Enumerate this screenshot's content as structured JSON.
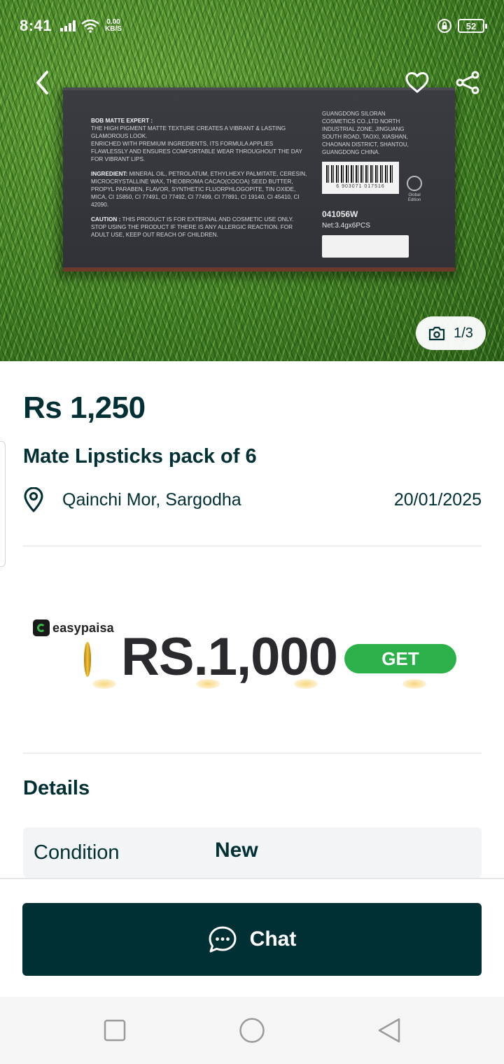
{
  "status_bar": {
    "time": "8:41",
    "speed_value": "0.00",
    "speed_unit": "KB/S",
    "battery": "52"
  },
  "header": {
    "back_icon": "chevron-left-icon",
    "favorite_icon": "heart-outline-icon",
    "share_icon": "share-icon"
  },
  "gallery": {
    "counter": "1/3",
    "counter_icon": "camera-icon",
    "box_text": {
      "heading": "BOB MATTE EXPERT :",
      "desc1": "THE HIGH PIGMENT MATTE TEXTURE CREATES A VIBRANT & LASTING GLAMOROUS LOOK.",
      "desc2": "ENRICHED WITH PREMIUM INGREDIENTS, ITS FORMULA APPLIES FLAWLESSLY AND ENSURES COMFORTABLE WEAR THROUGHOUT THE DAY FOR VIBRANT LIPS.",
      "ingredients_label": "INGREDIENT:",
      "ingredients": "MINERAL OIL, PETROLATUM, ETHYLHEXY PALMITATE, CERESIN, MICROCRYSTALLINE WAX, THEOBROMA CACAO(COCOA) SEED BUTTER, PROPYL PARABEN, FLAVOR, SYNTHETIC FLUORPHLOGOPITE, TIN OXIDE, MICA, CI 15850, CI 77491, CI 77492, CI 77499, CI 77891, CI 19140, CI 45410, CI 42090.",
      "caution_label": "CAUTION :",
      "caution": "THIS PRODUCT IS FOR EXTERNAL AND COSMETIC USE ONLY. STOP USING THE PRODUCT IF THERE IS ANY ALLERGIC REACTION. FOR ADULT USE, KEEP OUT REACH OF CHILDREN.",
      "manufacturer": "GUANGDONG SILORAN COSMETICS CO.,LTD NORTH INDUSTRIAL ZONE, JINGUANG SOUTH ROAD, TAOXI, XIASHAN, CHAONAN DISTRICT, SHANTOU, GUANGDONG CHINA.",
      "barcode_digits": "6 903071 017516",
      "global_edition": "Global Edition",
      "code": "041056W",
      "net": "Net:3.4gx6PCS"
    }
  },
  "listing": {
    "price": "Rs 1,250",
    "title": "Mate Lipsticks pack of 6",
    "location_icon": "location-pin-icon",
    "location": "Qainchi Mor, Sargodha",
    "date": "20/01/2025"
  },
  "ad": {
    "brand": "easypaisa",
    "amount": "RS.1,000",
    "cta": "GET"
  },
  "details": {
    "heading": "Details",
    "rows": [
      {
        "key": "Condition",
        "value": "New"
      }
    ]
  },
  "actions": {
    "chat_label": "Chat",
    "chat_icon": "chat-bubble-icon"
  },
  "system_nav": {
    "recents_icon": "square-icon",
    "home_icon": "circle-icon",
    "back_icon": "triangle-back-icon"
  },
  "colors": {
    "primary": "#002f34",
    "ad_green": "#2bb04a",
    "detail_bg": "#f2f4f5"
  }
}
